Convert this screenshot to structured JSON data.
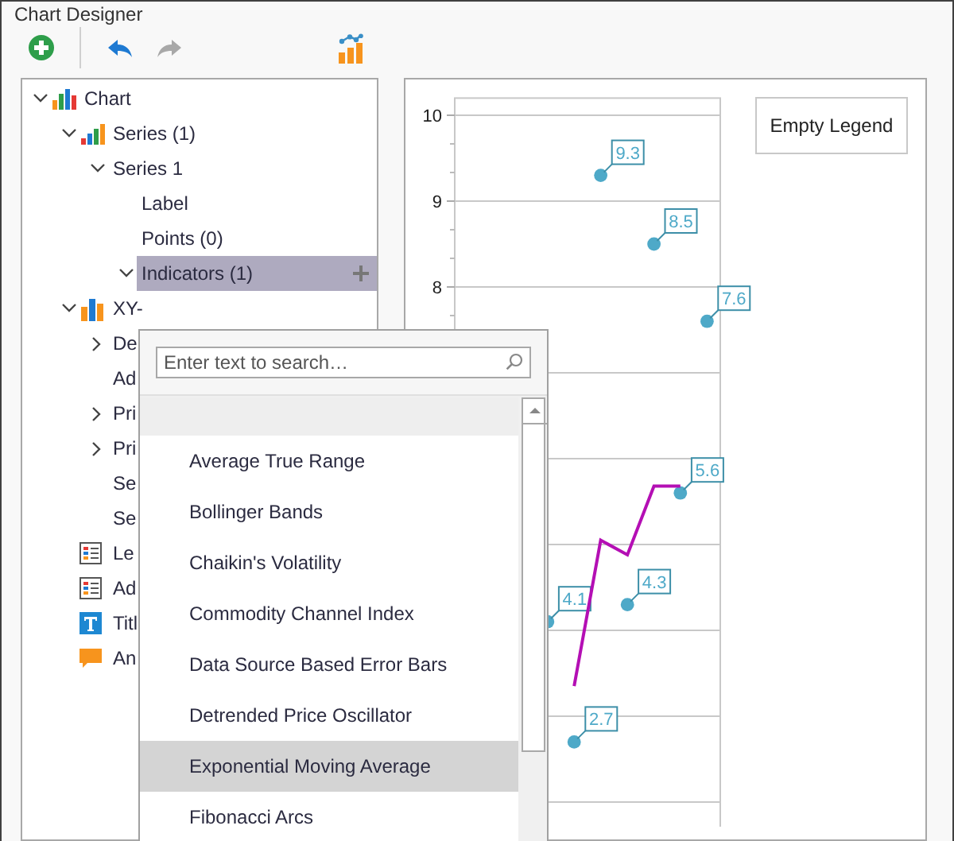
{
  "window": {
    "title": "Chart Designer"
  },
  "toolbar": [
    {
      "kind": "add",
      "disabled": false
    },
    {
      "kind": "undo",
      "disabled": false
    },
    {
      "kind": "redo",
      "disabled": true
    },
    {
      "kind": "wizard",
      "disabled": false
    }
  ],
  "tree": {
    "items": [
      {
        "label": "Chart",
        "kind": "chart",
        "expanded": true,
        "selected": false,
        "children": [
          {
            "label": "Series (1)",
            "kind": "series",
            "expanded": true,
            "selected": false,
            "children": [
              {
                "label": "Series 1",
                "expanded": true,
                "selected": false,
                "children": [
                  {
                    "label": "Label",
                    "selected": false
                  },
                  {
                    "label": "Points (0)",
                    "selected": false
                  },
                  {
                    "label": "Indicators (1)",
                    "expanded": true,
                    "selected": true
                  }
                ]
              }
            ]
          },
          {
            "label": "XY-",
            "kind": "diagram",
            "expanded": true,
            "selected": false,
            "children": [
              {
                "label": "De",
                "expanded": false,
                "selected": false
              },
              {
                "label": "Ad",
                "selected": false
              },
              {
                "label": "Pri",
                "expanded": false,
                "selected": false
              },
              {
                "label": "Pri",
                "expanded": false,
                "selected": false
              },
              {
                "label": "Se",
                "selected": false
              },
              {
                "label": "Se",
                "selected": false
              }
            ]
          },
          {
            "label": "Le",
            "kind": "legend",
            "selected": false
          },
          {
            "label": "Ad",
            "kind": "legend",
            "selected": false
          },
          {
            "label": "Titl",
            "kind": "title",
            "selected": false
          },
          {
            "label": "An",
            "kind": "annotation",
            "selected": false
          }
        ]
      }
    ]
  },
  "chart": {
    "legend": "Empty Legend",
    "chart_data": {
      "type": "scatter",
      "categories": [
        null,
        null,
        null,
        null,
        null,
        null,
        null,
        null,
        null,
        null
      ],
      "ylim": [
        2,
        10.2
      ],
      "yticks": [
        8,
        9,
        10
      ],
      "grid": true,
      "series": [
        {
          "color": "#4ea9c8",
          "values": [
            null,
            null,
            null,
            4.1,
            2.7,
            9.3,
            4.3,
            8.5,
            5.6,
            7.6
          ],
          "value_labels": [
            null,
            null,
            null,
            "4.1",
            "2.7",
            "9.3",
            "4.3",
            "8.5",
            "5.6",
            "7.6"
          ]
        },
        {
          "type": "line",
          "color": "#b40fb4",
          "values": [
            null,
            null,
            null,
            null,
            3.35,
            5.05,
            4.88,
            5.68,
            5.68,
            null
          ]
        }
      ]
    }
  },
  "popup": {
    "search": {
      "placeholder": "Enter text to search…"
    },
    "items": [
      {
        "label": "Average True Range",
        "highlighted": false
      },
      {
        "label": "Bollinger Bands",
        "highlighted": false
      },
      {
        "label": "Chaikin's Volatility",
        "highlighted": false
      },
      {
        "label": "Commodity Channel Index",
        "highlighted": false
      },
      {
        "label": "Data Source Based Error Bars",
        "highlighted": false
      },
      {
        "label": "Detrended Price Oscillator",
        "highlighted": false
      },
      {
        "label": "Exponential Moving Average",
        "highlighted": true
      },
      {
        "label": "Fibonacci Arcs",
        "highlighted": false
      }
    ]
  }
}
